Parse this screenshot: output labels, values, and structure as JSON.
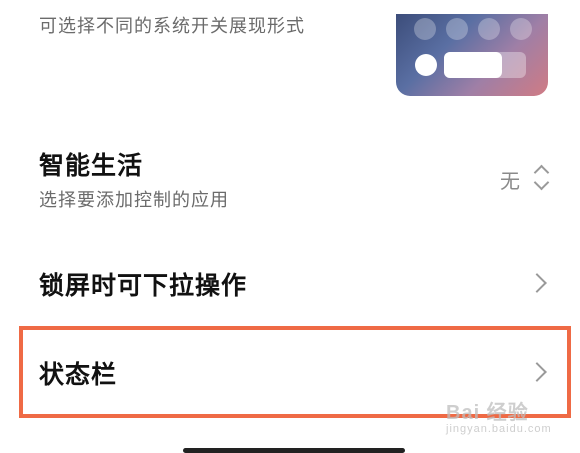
{
  "style_option": {
    "description": "可选择不同的系统开关展现形式"
  },
  "smart_life": {
    "title": "智能生活",
    "description": "选择要添加控制的应用",
    "value": "无"
  },
  "lock_screen_pulldown": {
    "title": "锁屏时可下拉操作"
  },
  "status_bar": {
    "title": "状态栏"
  },
  "watermark": {
    "main": "Bai 经验",
    "sub": "jingyan.baidu.com"
  },
  "colors": {
    "highlight_border": "#ef6a45",
    "title_text": "#111111",
    "secondary_text": "#6b6b6b"
  }
}
